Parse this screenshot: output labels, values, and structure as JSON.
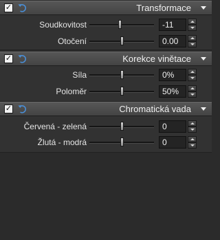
{
  "sections": [
    {
      "title": "Transformace",
      "enabled": true,
      "params": [
        {
          "label": "Soudkovitost",
          "value": "-11",
          "slider": 0.47
        },
        {
          "label": "Otočení",
          "value": "0.00",
          "slider": 0.5
        }
      ]
    },
    {
      "title": "Korekce vinětace",
      "enabled": true,
      "params": [
        {
          "label": "Síla",
          "value": "0%",
          "slider": 0.5
        },
        {
          "label": "Poloměr",
          "value": "50%",
          "slider": 0.5
        }
      ]
    },
    {
      "title": "Chromatická vada",
      "enabled": true,
      "params": [
        {
          "label": "Červená - zelená",
          "value": "0",
          "slider": 0.5
        },
        {
          "label": "Žlutá - modrá",
          "value": "0",
          "slider": 0.5
        }
      ]
    }
  ],
  "icons": {
    "check": "✓",
    "reset": "reset-arrow-icon",
    "dropdown": "chevron-down-icon"
  },
  "colors": {
    "reset_icon": "#4a8fd8",
    "panel": "#323232",
    "header": "#4b4b4b"
  }
}
